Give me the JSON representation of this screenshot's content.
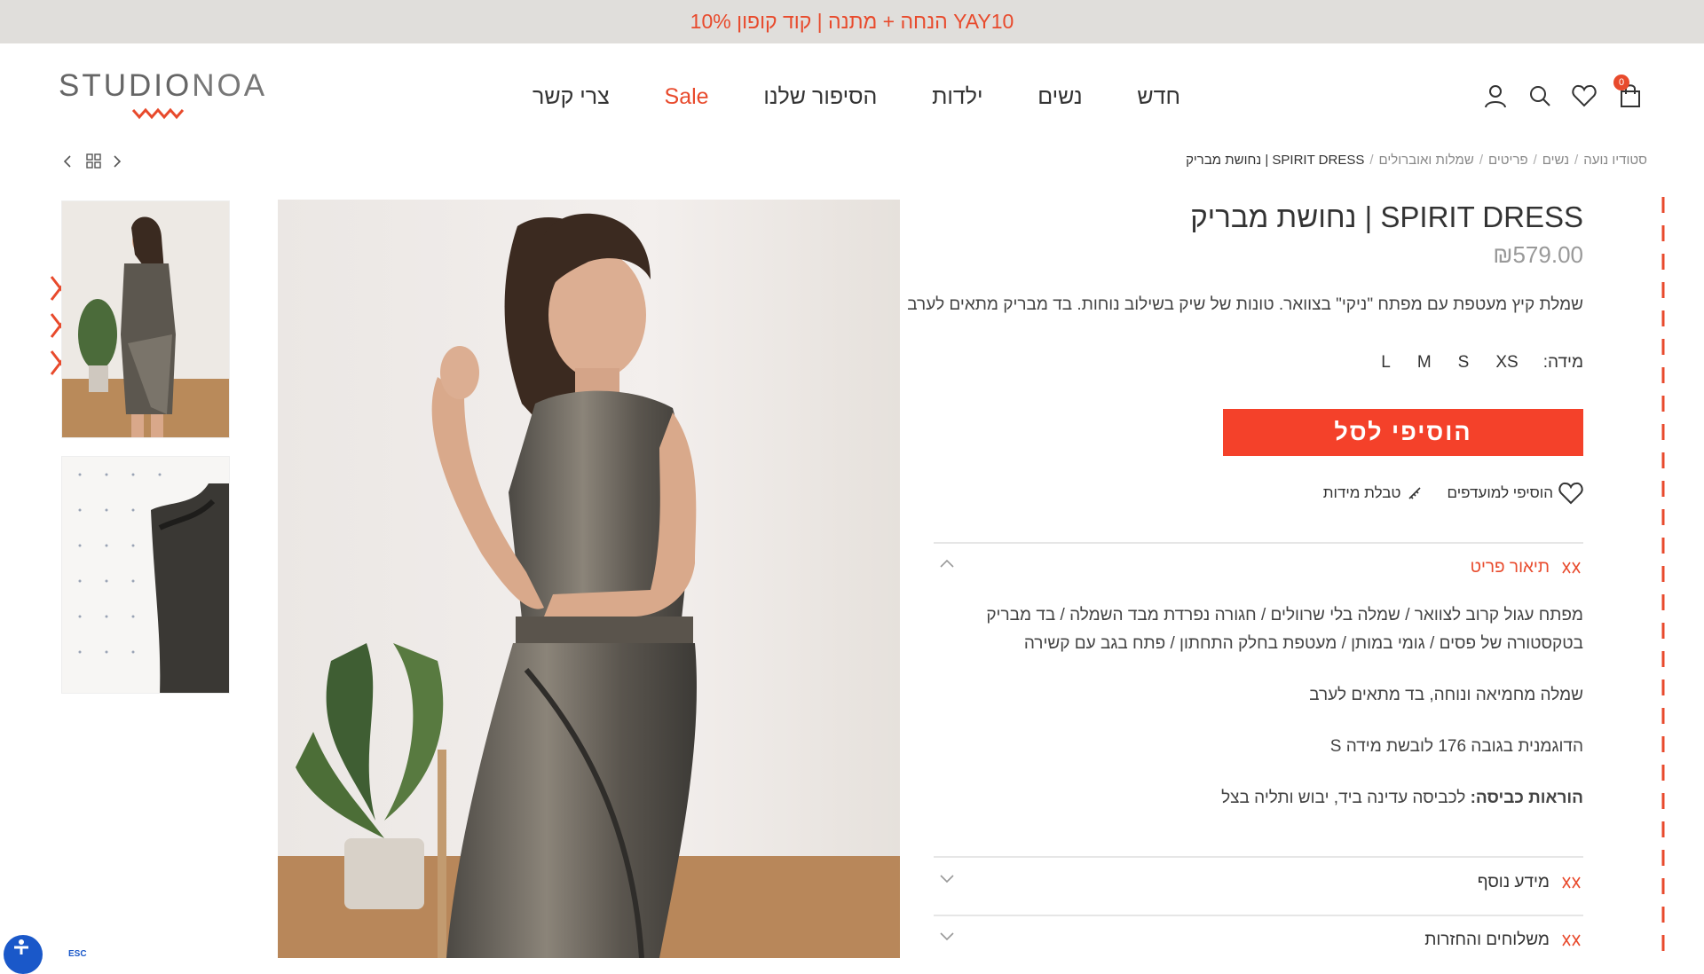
{
  "promo": {
    "text": "10% הנחה + מתנה | קוד קופון YAY10"
  },
  "brand": {
    "logo_studio": "STUDIO",
    "logo_noa": "NOA"
  },
  "nav": {
    "items": [
      {
        "label": "חדש"
      },
      {
        "label": "נשים"
      },
      {
        "label": "ילדות"
      },
      {
        "label": "הסיפור שלנו"
      },
      {
        "label": "Sale"
      },
      {
        "label": "צרי קשר"
      }
    ]
  },
  "header_icons": {
    "cart_count": "0"
  },
  "breadcrumb": {
    "items": [
      "סטודיו נועה",
      "נשים",
      "פריטים",
      "שמלות ואוברולים"
    ],
    "separator": "/",
    "current": "SPIRIT DRESS | נחושת מבריק"
  },
  "product": {
    "title": "SPIRIT DRESS | נחושת מבריק",
    "price": "₪579.00",
    "description": "שמלת קיץ מעטפת עם מפתח \"ניקי\" בצוואר. טונות של שיק בשילוב נוחות. בד מבריק מתאים לערב",
    "size_label": "מידה:",
    "sizes": [
      "XS",
      "S",
      "M",
      "L"
    ],
    "add_to_cart": "הוסיפי לסל",
    "wishlist": "הוסיפי למועדפים",
    "size_chart": "טבלת מידות"
  },
  "accordion": {
    "description_title": "תיאור פריט",
    "description_paragraphs": [
      "מפתח עגול קרוב לצוואר / שמלה בלי שרוולים / חגורה נפרדת מבד השמלה / בד מבריק בטקסטורה של פסים / גומי במותן / מעטפת בחלק התחתון / פתח בגב עם קשירה",
      "שמלה מחמיאה ונוחה, בד מתאים לערב",
      "הדוגמנית בגובה 176 לובשת מידה S"
    ],
    "care_label": "הוראות כביסה:",
    "care_text": " לכביסה עדינה ביד, יבוש ותליה בצל",
    "more_info_title": "מידע נוסף",
    "shipping_title": "משלוחים והחזרות"
  },
  "accessibility": {
    "esc_label": "ESC"
  },
  "colors": {
    "accent": "#e84a2c",
    "button": "#f4412a",
    "promo_bg": "#e0dedb"
  }
}
